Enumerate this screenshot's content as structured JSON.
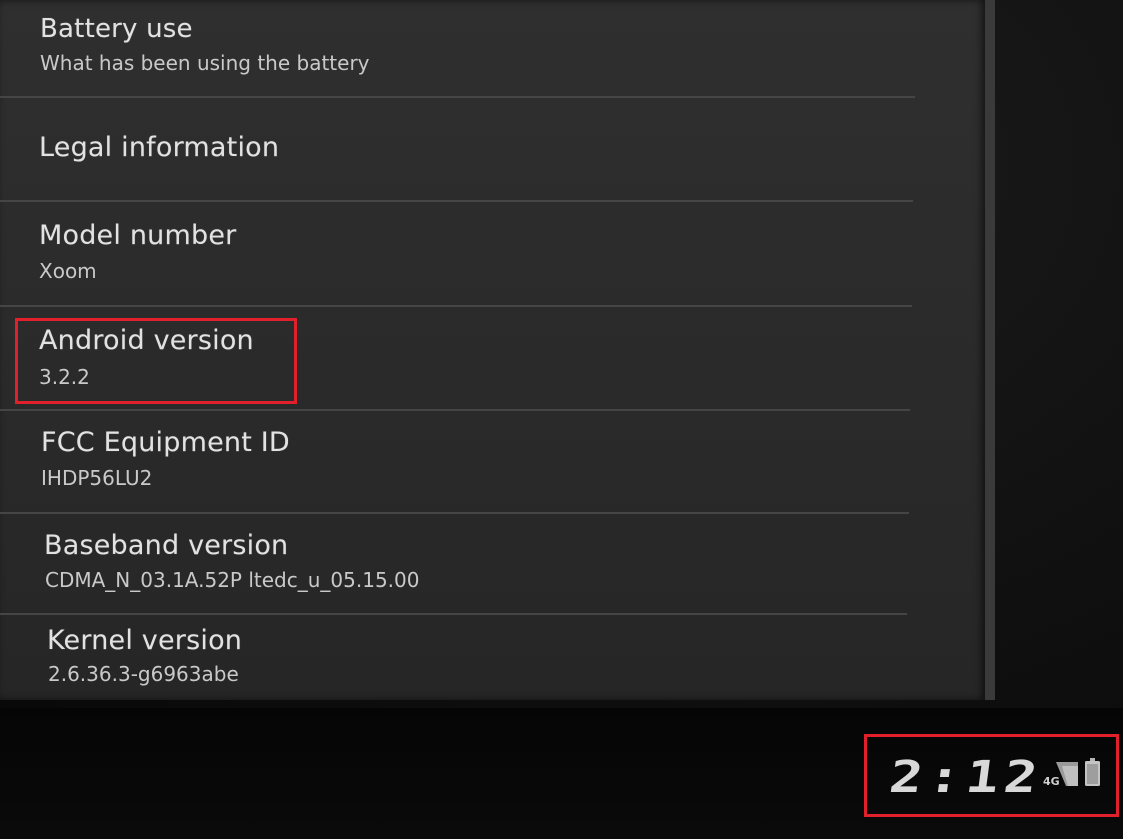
{
  "settings_list": {
    "items": [
      {
        "title": "Battery use",
        "summary": "What has been using the battery"
      },
      {
        "title": "Legal information",
        "summary": ""
      },
      {
        "title": "Model number",
        "summary": "Xoom"
      },
      {
        "title": "Android version",
        "summary": "3.2.2"
      },
      {
        "title": "FCC Equipment ID",
        "summary": "IHDP56LU2"
      },
      {
        "title": "Baseband version",
        "summary": "CDMA_N_03.1A.52P ltedc_u_05.15.00"
      },
      {
        "title": "Kernel version",
        "summary": "2.6.36.3-g6963abe"
      }
    ]
  },
  "status_bar": {
    "clock": "2:12",
    "network_type": "4G"
  },
  "colors": {
    "annotation": "#e0202a",
    "screen_background": "#2b2b2b",
    "text_primary": "#e2e2e2"
  },
  "icons": {
    "signal": "signal-strength-icon",
    "battery": "battery-icon"
  }
}
